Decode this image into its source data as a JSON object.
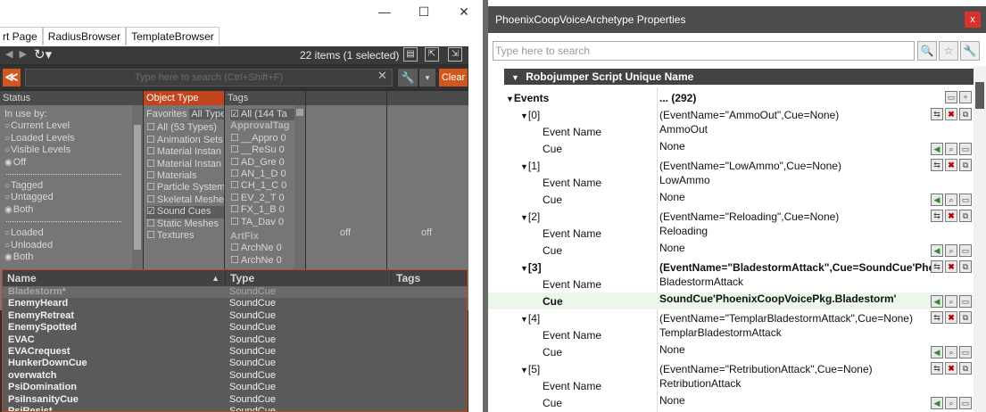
{
  "left_window": {
    "controls": {
      "minimize": "—",
      "maximize": "☐",
      "close": "✕"
    },
    "tabs": [
      "rt Page",
      "RadiusBrowser",
      "TemplateBrowser"
    ],
    "toolbar": {
      "back": "◀",
      "forward": "▶",
      "history": "↻▾",
      "count": "22 items (1 selected)",
      "search_placeholder": "Type here to search  (Ctrl+Shift+F)",
      "clear_x": "✕",
      "wrench": "🔧",
      "dropdown": "▾",
      "clear_label": "Clear",
      "collapse": "≪"
    },
    "filters": {
      "status_header": "Status",
      "object_type_header": "Object Type",
      "tags_header": "Tags",
      "status": {
        "in_use_by": "In use by:",
        "group1": [
          {
            "label": "Current Level",
            "on": false
          },
          {
            "label": "Loaded Levels",
            "on": false
          },
          {
            "label": "Visible Levels",
            "on": false
          },
          {
            "label": "Off",
            "on": true
          }
        ],
        "group2": [
          {
            "label": "Tagged",
            "on": false
          },
          {
            "label": "Untagged",
            "on": false
          },
          {
            "label": "Both",
            "on": true
          }
        ],
        "group3": [
          {
            "label": "Loaded",
            "on": false
          },
          {
            "label": "Unloaded",
            "on": false
          },
          {
            "label": "Both",
            "on": true
          }
        ]
      },
      "object_type": {
        "favorites": "Favorites",
        "all_types": "All Types",
        "items": [
          {
            "label": "All (53 Types)",
            "on": false
          },
          {
            "label": "Animation Sets",
            "on": false
          },
          {
            "label": "Material Instan",
            "on": false
          },
          {
            "label": "Material Instan",
            "on": false
          },
          {
            "label": "Materials",
            "on": false
          },
          {
            "label": "Particle System",
            "on": false
          },
          {
            "label": "Skeletal Meshe",
            "on": false
          },
          {
            "label": "Sound Cues",
            "on": true
          },
          {
            "label": "Static Meshes",
            "on": false
          },
          {
            "label": "Textures",
            "on": false
          }
        ]
      },
      "tags": {
        "all": "All (144 Ta",
        "group1": "ApprovalTag",
        "items": [
          "__Appro 0",
          "__ReSu 0",
          "AD_Gre 0",
          "AN_1_D 0",
          "CH_1_C 0",
          "EV_2_T 0",
          "FX_1_B 0",
          "TA_Dav 0"
        ],
        "group2": "ArtFix",
        "items2": [
          "ArchNe 0",
          "ArchNe 0"
        ]
      },
      "off_label_1": "off",
      "off_label_2": "off"
    },
    "results": {
      "headers": {
        "name": "Name",
        "type": "Type",
        "tags": "Tags",
        "sort": "▲"
      },
      "rows": [
        {
          "name": "Bladestorm*",
          "type": "SoundCue",
          "selected": true
        },
        {
          "name": "EnemyHeard",
          "type": "SoundCue"
        },
        {
          "name": "EnemyRetreat",
          "type": "SoundCue"
        },
        {
          "name": "EnemySpotted",
          "type": "SoundCue"
        },
        {
          "name": "EVAC",
          "type": "SoundCue"
        },
        {
          "name": "EVACrequest",
          "type": "SoundCue"
        },
        {
          "name": "HunkerDownCue",
          "type": "SoundCue"
        },
        {
          "name": "overwatch",
          "type": "SoundCue"
        },
        {
          "name": "PsiDomination",
          "type": "SoundCue"
        },
        {
          "name": "PsiInsanityCue",
          "type": "SoundCue"
        },
        {
          "name": "PsiResist",
          "type": "SoundCue"
        }
      ]
    }
  },
  "right_window": {
    "title": "PhoenixCoopVoiceArchetype Properties",
    "close": "x",
    "search_placeholder": "Type here to search",
    "search_icons": {
      "find": "🔍",
      "favorite": "☆",
      "options": "🔧"
    },
    "category": "Robojumper Script Unique Name",
    "events_label": "Events",
    "events_value": "... (292)",
    "rows": [
      {
        "kind": "elem",
        "key": "[0]",
        "value": "(EventName=\"AmmoOut\",Cue=None)"
      },
      {
        "kind": "prop",
        "key": "Event Name",
        "value": "AmmoOut"
      },
      {
        "kind": "cue",
        "key": "Cue",
        "value": "None"
      },
      {
        "kind": "elem",
        "key": "[1]",
        "value": "(EventName=\"LowAmmo\",Cue=None)"
      },
      {
        "kind": "prop",
        "key": "Event Name",
        "value": "LowAmmo"
      },
      {
        "kind": "cue",
        "key": "Cue",
        "value": "None"
      },
      {
        "kind": "elem",
        "key": "[2]",
        "value": "(EventName=\"Reloading\",Cue=None)"
      },
      {
        "kind": "prop",
        "key": "Event Name",
        "value": "Reloading"
      },
      {
        "kind": "cue",
        "key": "Cue",
        "value": "None"
      },
      {
        "kind": "elem",
        "key": "[3]",
        "value": "(EventName=\"BladestormAttack\",Cue=SoundCue'Pho",
        "bold": true
      },
      {
        "kind": "prop",
        "key": "Event Name",
        "value": "BladestormAttack"
      },
      {
        "kind": "cue",
        "key": "Cue",
        "value": "SoundCue'PhoenixCoopVoicePkg.Bladestorm'",
        "bold": true,
        "highlight": true
      },
      {
        "kind": "elem",
        "key": "[4]",
        "value": "(EventName=\"TemplarBladestormAttack\",Cue=None)"
      },
      {
        "kind": "prop",
        "key": "Event Name",
        "value": "TemplarBladestormAttack"
      },
      {
        "kind": "cue",
        "key": "Cue",
        "value": "None"
      },
      {
        "kind": "elem",
        "key": "[5]",
        "value": "(EventName=\"RetributionAttack\",Cue=None)"
      },
      {
        "kind": "prop",
        "key": "Event Name",
        "value": "RetributionAttack"
      },
      {
        "kind": "cue",
        "key": "Cue",
        "value": "None"
      }
    ]
  }
}
